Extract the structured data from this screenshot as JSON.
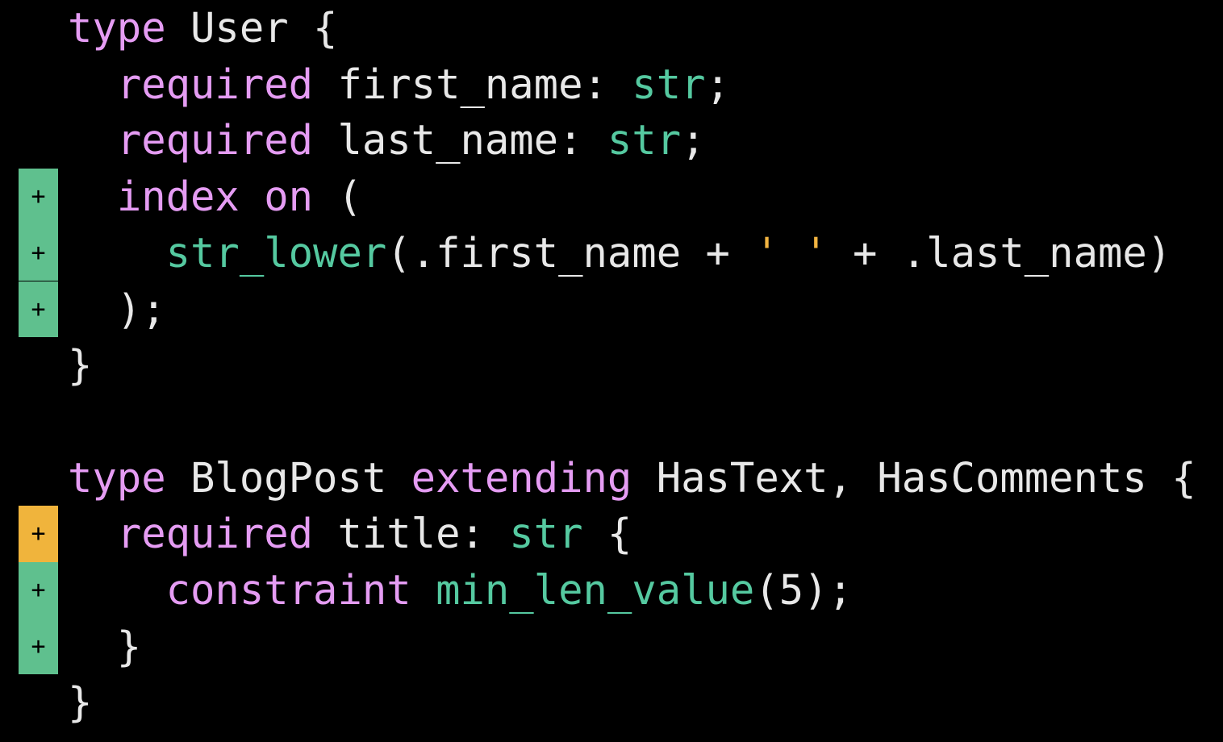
{
  "colors": {
    "background": "#000000",
    "keyword": "#e59cf3",
    "builtin": "#55c9a0",
    "string": "#f2b441",
    "plain": "#e8e8e8",
    "gutter_added": "#5fc08e",
    "gutter_changed": "#f0b43c"
  },
  "lines": [
    {
      "marker": "",
      "status": "none",
      "tokens": [
        {
          "t": "kw",
          "v": "type"
        },
        {
          "t": "plain",
          "v": " User {"
        }
      ]
    },
    {
      "marker": "",
      "status": "none",
      "tokens": [
        {
          "t": "plain",
          "v": "  "
        },
        {
          "t": "kw",
          "v": "required"
        },
        {
          "t": "plain",
          "v": " first_name: "
        },
        {
          "t": "fn",
          "v": "str"
        },
        {
          "t": "plain",
          "v": ";"
        }
      ]
    },
    {
      "marker": "",
      "status": "none",
      "tokens": [
        {
          "t": "plain",
          "v": "  "
        },
        {
          "t": "kw",
          "v": "required"
        },
        {
          "t": "plain",
          "v": " last_name: "
        },
        {
          "t": "fn",
          "v": "str"
        },
        {
          "t": "plain",
          "v": ";"
        }
      ]
    },
    {
      "marker": "+",
      "status": "added",
      "tokens": [
        {
          "t": "plain",
          "v": "  "
        },
        {
          "t": "kw",
          "v": "index"
        },
        {
          "t": "plain",
          "v": " "
        },
        {
          "t": "kw",
          "v": "on"
        },
        {
          "t": "plain",
          "v": " ("
        }
      ]
    },
    {
      "marker": "+",
      "status": "added",
      "tokens": [
        {
          "t": "plain",
          "v": "    "
        },
        {
          "t": "fn",
          "v": "str_lower"
        },
        {
          "t": "plain",
          "v": "(.first_name + "
        },
        {
          "t": "str",
          "v": "' '"
        },
        {
          "t": "plain",
          "v": " + .last_name)"
        }
      ]
    },
    {
      "marker": "+",
      "status": "added",
      "tokens": [
        {
          "t": "plain",
          "v": "  );"
        }
      ]
    },
    {
      "marker": "",
      "status": "none",
      "tokens": [
        {
          "t": "plain",
          "v": "}"
        }
      ]
    },
    {
      "marker": "",
      "status": "none",
      "tokens": []
    },
    {
      "marker": "",
      "status": "none",
      "tokens": [
        {
          "t": "kw",
          "v": "type"
        },
        {
          "t": "plain",
          "v": " BlogPost "
        },
        {
          "t": "kw",
          "v": "extending"
        },
        {
          "t": "plain",
          "v": " HasText, HasComments {"
        }
      ]
    },
    {
      "marker": "+",
      "status": "changed",
      "tokens": [
        {
          "t": "plain",
          "v": "  "
        },
        {
          "t": "kw",
          "v": "required"
        },
        {
          "t": "plain",
          "v": " title: "
        },
        {
          "t": "fn",
          "v": "str"
        },
        {
          "t": "plain",
          "v": " {"
        }
      ]
    },
    {
      "marker": "+",
      "status": "added",
      "tokens": [
        {
          "t": "plain",
          "v": "    "
        },
        {
          "t": "kw",
          "v": "constraint"
        },
        {
          "t": "plain",
          "v": " "
        },
        {
          "t": "fn",
          "v": "min_len_value"
        },
        {
          "t": "plain",
          "v": "(5);"
        }
      ]
    },
    {
      "marker": "+",
      "status": "added",
      "tokens": [
        {
          "t": "plain",
          "v": "  }"
        }
      ]
    },
    {
      "marker": "",
      "status": "none",
      "tokens": [
        {
          "t": "plain",
          "v": "}"
        }
      ]
    }
  ]
}
